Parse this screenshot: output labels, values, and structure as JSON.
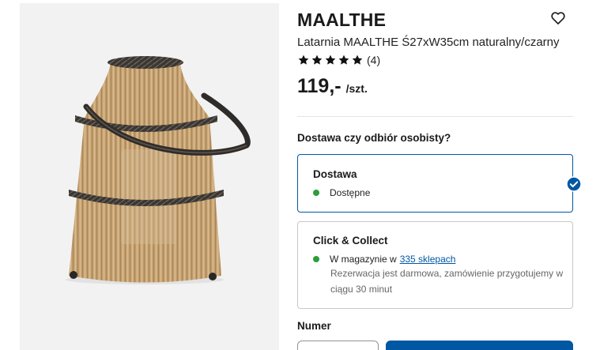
{
  "product": {
    "name": "MAALTHE",
    "description": "Latarnia MAALTHE Ś27xW35cm naturalny/czarny",
    "rating_count": "(4)",
    "rating_stars": 5,
    "price": "119,-",
    "price_unit": "/szt.",
    "image_icon": "lantern-image"
  },
  "delivery": {
    "heading": "Dostawa czy odbiór osobisty?",
    "options": [
      {
        "title": "Dostawa",
        "status": "Dostępne",
        "selected": true
      },
      {
        "title": "Click & Collect",
        "status_prefix": "W magazynie w",
        "status_link": "335 sklepach",
        "note": "Rezerwacja jest darmowa, zamówienie przygotujemy w ciągu 30 minut",
        "selected": false
      }
    ]
  },
  "quantity": {
    "label": "Numer"
  },
  "icons": {
    "favorite": "heart-icon",
    "star": "star-icon",
    "selected": "check-circle-icon",
    "available": "green-dot-icon"
  },
  "colors": {
    "accent": "#0058a3",
    "available": "#2d9e3a",
    "image_bg": "#f2f2f2"
  }
}
